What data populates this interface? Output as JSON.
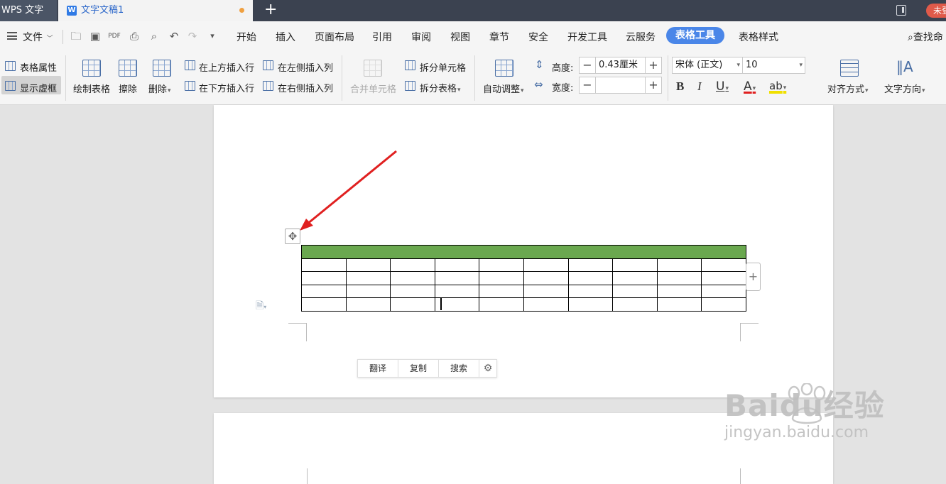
{
  "titlebar": {
    "app_name": "WPS 文字",
    "doc_tab": "文字文稿1",
    "new_tab": "+",
    "login": "未登"
  },
  "menu": {
    "file": "文件",
    "tabs": [
      "开始",
      "插入",
      "页面布局",
      "引用",
      "审阅",
      "视图",
      "章节",
      "安全",
      "开发工具",
      "云服务",
      "表格工具",
      "表格样式"
    ],
    "active_tab": "表格工具",
    "search": "查找命"
  },
  "ribbon": {
    "table_props": "表格属性",
    "show_gridlines": "显示虚框",
    "draw_table": "绘制表格",
    "erase": "擦除",
    "delete": "删除",
    "insert_row_above": "在上方插入行",
    "insert_row_below": "在下方插入行",
    "insert_col_left": "在左侧插入列",
    "insert_col_right": "在右侧插入列",
    "merge_cells": "合并单元格",
    "split_cells": "拆分单元格",
    "split_table": "拆分表格",
    "autofit": "自动调整",
    "height_label": "高度:",
    "height_value": "0.43厘米",
    "width_label": "宽度:",
    "width_value": "",
    "font_name": "宋体 (正文)",
    "font_size": "10",
    "bold": "B",
    "italic": "I",
    "underline": "U",
    "font_color": "A",
    "highlight": "ab",
    "align": "对齐方式",
    "text_direction": "文字方向"
  },
  "document": {
    "table": {
      "rows": 5,
      "cols": 10,
      "header_color": "#6aa84f"
    },
    "mini_toolbar": [
      "翻译",
      "复制",
      "搜索"
    ]
  },
  "watermark": {
    "brand": "Baidu经验",
    "url": "jingyan.baidu.com"
  },
  "colors": {
    "titlebar": "#3b4250",
    "active_tab": "#4a86e8",
    "arrow": "#e02020"
  }
}
